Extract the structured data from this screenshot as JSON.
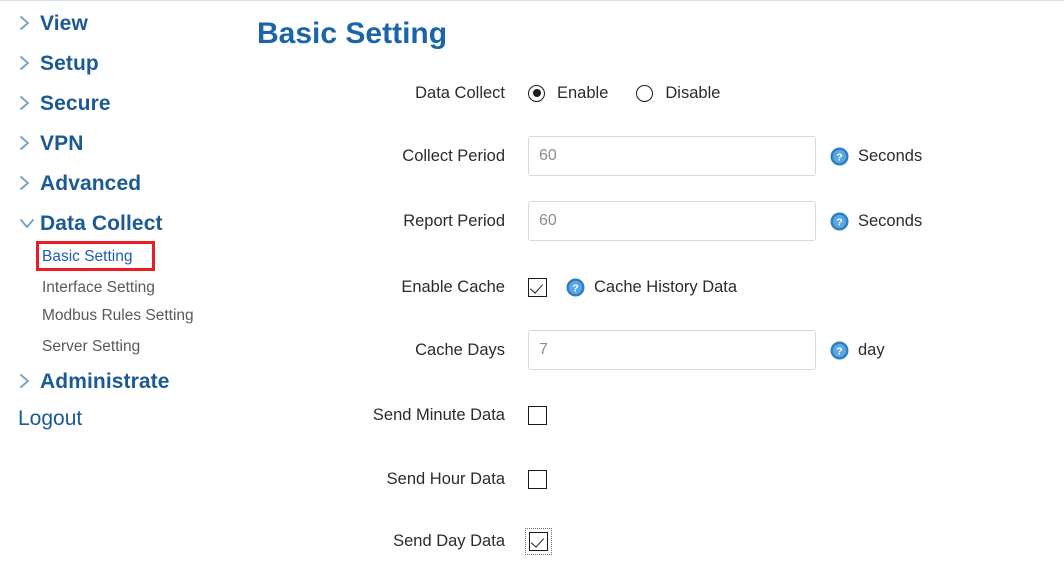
{
  "sidebar": {
    "top_items": [
      {
        "label": "View",
        "icon": "chevron-right-icon",
        "expanded": false
      },
      {
        "label": "Setup",
        "icon": "chevron-right-icon",
        "expanded": false
      },
      {
        "label": "Secure",
        "icon": "chevron-right-icon",
        "expanded": false
      },
      {
        "label": "VPN",
        "icon": "chevron-right-icon",
        "expanded": false
      },
      {
        "label": "Advanced",
        "icon": "chevron-right-icon",
        "expanded": false
      },
      {
        "label": "Data Collect",
        "icon": "chevron-down-icon",
        "expanded": true
      }
    ],
    "sub_items": [
      {
        "label": "Basic Setting",
        "active": true
      },
      {
        "label": "Interface Setting",
        "active": false
      },
      {
        "label": "Modbus Rules Setting",
        "active": false
      },
      {
        "label": "Server Setting",
        "active": false
      }
    ],
    "administrate": {
      "label": "Administrate",
      "icon": "chevron-right-icon"
    },
    "logout": {
      "label": "Logout"
    },
    "highlight_color": "#ee1c22",
    "link_color": "#1a5fb4",
    "heading_color": "#1b5a96"
  },
  "main": {
    "title": "Basic Setting",
    "title_color": "#1a64a8",
    "rows": {
      "data_collect": {
        "label": "Data Collect",
        "enable_label": "Enable",
        "disable_label": "Disable",
        "selected": "Enable"
      },
      "collect_period": {
        "label": "Collect Period",
        "value": "60",
        "placeholder": "60",
        "unit": "Seconds",
        "help_icon": "help-question-icon"
      },
      "report_period": {
        "label": "Report Period",
        "value": "60",
        "placeholder": "60",
        "unit": "Seconds",
        "help_icon": "help-question-icon"
      },
      "enable_cache": {
        "label": "Enable Cache",
        "checked": true,
        "hint": "Cache History Data",
        "help_icon": "help-question-icon"
      },
      "cache_days": {
        "label": "Cache Days",
        "value": "7",
        "placeholder": "7",
        "unit": "day",
        "help_icon": "help-question-icon"
      },
      "send_minute_data": {
        "label": "Send Minute Data",
        "checked": false
      },
      "send_hour_data": {
        "label": "Send Hour Data",
        "checked": false
      },
      "send_day_data": {
        "label": "Send Day Data",
        "checked": true,
        "focused": true
      }
    }
  }
}
